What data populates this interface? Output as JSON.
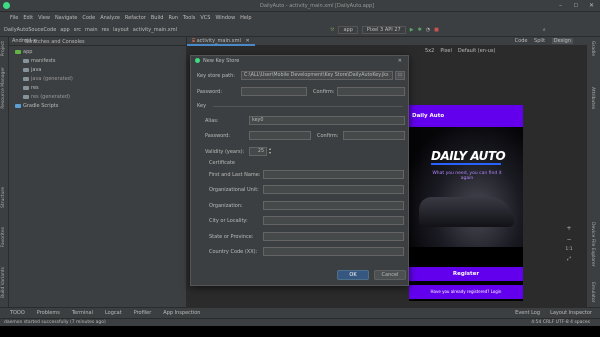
{
  "window": {
    "title": "DailyAuto - activity_main.xml [DailyAuto.app]"
  },
  "menu": [
    "File",
    "Edit",
    "View",
    "Navigate",
    "Code",
    "Analyze",
    "Refactor",
    "Build",
    "Run",
    "Tools",
    "VCS",
    "Window",
    "Help"
  ],
  "breadcrumb": [
    "DailyAutoSouceCode",
    "app",
    "src",
    "main",
    "res",
    "layout",
    "activity_main.xml"
  ],
  "toolbar": {
    "run_config": "app",
    "device": "Pixel 3 API 27"
  },
  "project": {
    "view": "Android",
    "tab_scratches": "Scratches and Consoles",
    "tree": [
      "app",
      "manifests",
      "java",
      "java (generated)",
      "res",
      "res (generated)",
      "Gradle Scripts"
    ]
  },
  "editor": {
    "tab": "activity_main.xml",
    "modes": [
      "Code",
      "Split",
      "Design"
    ],
    "theme": "Default (en-us)",
    "zoom": "5x2",
    "pixel": "Pixel"
  },
  "phone": {
    "app_title": "Daily Auto",
    "logo": "DAILY AUTO",
    "tagline": "What you need, you can find it again",
    "register": "Register",
    "login_prompt": "Have you already registered? Login"
  },
  "dialog": {
    "title": "New Key Store",
    "keystore_path_label": "Key store path:",
    "keystore_path": "C:\\ALL\\User\\Mobile Development\\Key Store\\DailyAutoKey.jks",
    "password_label": "Password:",
    "confirm_label": "Confirm:",
    "key_section": "Key",
    "alias_label": "Alias:",
    "alias": "key0",
    "key_password_label": "Password:",
    "key_confirm_label": "Confirm:",
    "validity_label": "Validity (years):",
    "validity": "25",
    "certificate_label": "Certificate",
    "fields": [
      "First and Last Name:",
      "Organizational Unit:",
      "Organization:",
      "City or Locality:",
      "State or Province:",
      "Country Code (XX):"
    ],
    "ok": "OK",
    "cancel": "Cancel"
  },
  "bottom_tabs": [
    "TODO",
    "Problems",
    "Terminal",
    "Logcat",
    "Profiler",
    "App Inspection"
  ],
  "bottom_right_tabs": [
    "Event Log",
    "Layout Inspector"
  ],
  "status": {
    "message": "daemon started successfully (7 minutes ago)",
    "right": "4:54  CRLF  UTF-8  4 spaces"
  },
  "left_strip": [
    "Project",
    "Resource Manager",
    "Structure",
    "Favorites",
    "Build Variants"
  ],
  "right_strip": [
    "Gradle",
    "Attributes",
    "Device File Explorer",
    "Emulator"
  ],
  "colors": {
    "accent": "#4a88c7",
    "purple": "#6200ee"
  }
}
